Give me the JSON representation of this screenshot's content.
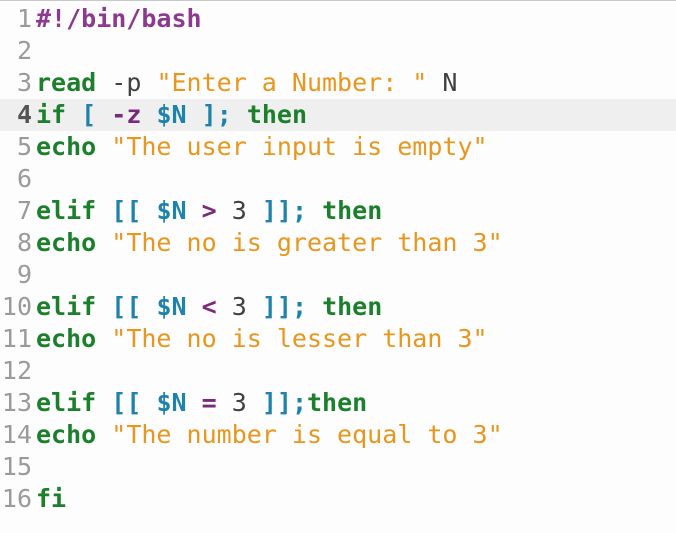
{
  "editor": {
    "current_line": 4,
    "lines": [
      {
        "number": "1",
        "tokens": [
          {
            "t": "#!/bin/bash",
            "c": "shebang"
          }
        ]
      },
      {
        "number": "2",
        "tokens": []
      },
      {
        "number": "3",
        "tokens": [
          {
            "t": "read",
            "c": "kw"
          },
          {
            "t": " -p ",
            "c": "plain"
          },
          {
            "t": "\"Enter a Number: \"",
            "c": "str"
          },
          {
            "t": " N",
            "c": "plain"
          }
        ]
      },
      {
        "number": "4",
        "tokens": [
          {
            "t": "if",
            "c": "kw"
          },
          {
            "t": " ",
            "c": "plain"
          },
          {
            "t": "[",
            "c": "brk"
          },
          {
            "t": " ",
            "c": "plain"
          },
          {
            "t": "-z",
            "c": "op"
          },
          {
            "t": " ",
            "c": "plain"
          },
          {
            "t": "$N",
            "c": "var"
          },
          {
            "t": " ",
            "c": "plain"
          },
          {
            "t": "];",
            "c": "brk"
          },
          {
            "t": " ",
            "c": "plain"
          },
          {
            "t": "then",
            "c": "kw"
          }
        ]
      },
      {
        "number": "5",
        "tokens": [
          {
            "t": "echo",
            "c": "kw"
          },
          {
            "t": " ",
            "c": "plain"
          },
          {
            "t": "\"The user input is empty\"",
            "c": "str"
          }
        ]
      },
      {
        "number": "6",
        "tokens": []
      },
      {
        "number": "7",
        "tokens": [
          {
            "t": "elif",
            "c": "kw"
          },
          {
            "t": " ",
            "c": "plain"
          },
          {
            "t": "[[",
            "c": "brk"
          },
          {
            "t": " ",
            "c": "plain"
          },
          {
            "t": "$N",
            "c": "var"
          },
          {
            "t": " ",
            "c": "plain"
          },
          {
            "t": ">",
            "c": "op"
          },
          {
            "t": " 3 ",
            "c": "plain"
          },
          {
            "t": "]];",
            "c": "brk"
          },
          {
            "t": " ",
            "c": "plain"
          },
          {
            "t": "then",
            "c": "kw"
          }
        ]
      },
      {
        "number": "8",
        "tokens": [
          {
            "t": "echo",
            "c": "kw"
          },
          {
            "t": " ",
            "c": "plain"
          },
          {
            "t": "\"The no is greater than 3\"",
            "c": "str"
          }
        ]
      },
      {
        "number": "9",
        "tokens": []
      },
      {
        "number": "10",
        "tokens": [
          {
            "t": "elif",
            "c": "kw"
          },
          {
            "t": " ",
            "c": "plain"
          },
          {
            "t": "[[",
            "c": "brk"
          },
          {
            "t": " ",
            "c": "plain"
          },
          {
            "t": "$N",
            "c": "var"
          },
          {
            "t": " ",
            "c": "plain"
          },
          {
            "t": "<",
            "c": "op"
          },
          {
            "t": " 3 ",
            "c": "plain"
          },
          {
            "t": "]];",
            "c": "brk"
          },
          {
            "t": " ",
            "c": "plain"
          },
          {
            "t": "then",
            "c": "kw"
          }
        ]
      },
      {
        "number": "11",
        "tokens": [
          {
            "t": "echo",
            "c": "kw"
          },
          {
            "t": " ",
            "c": "plain"
          },
          {
            "t": "\"The no is lesser than 3\"",
            "c": "str"
          }
        ]
      },
      {
        "number": "12",
        "tokens": []
      },
      {
        "number": "13",
        "tokens": [
          {
            "t": "elif",
            "c": "kw"
          },
          {
            "t": " ",
            "c": "plain"
          },
          {
            "t": "[[",
            "c": "brk"
          },
          {
            "t": " ",
            "c": "plain"
          },
          {
            "t": "$N",
            "c": "var"
          },
          {
            "t": " ",
            "c": "plain"
          },
          {
            "t": "=",
            "c": "op"
          },
          {
            "t": " 3 ",
            "c": "plain"
          },
          {
            "t": "]];",
            "c": "brk"
          },
          {
            "t": "then",
            "c": "kw"
          }
        ]
      },
      {
        "number": "14",
        "tokens": [
          {
            "t": "echo",
            "c": "kw"
          },
          {
            "t": " ",
            "c": "plain"
          },
          {
            "t": "\"The number is equal to 3\"",
            "c": "str"
          }
        ]
      },
      {
        "number": "15",
        "tokens": []
      },
      {
        "number": "16",
        "tokens": [
          {
            "t": "fi",
            "c": "kw"
          }
        ]
      }
    ]
  },
  "colors": {
    "keyword": "#1b7f2b",
    "shebang": "#8b3a8f",
    "string": "#e8961e",
    "variable": "#1d83ad",
    "operator": "#7a2a7a",
    "plain": "#404040",
    "line_number": "#9a9a9a",
    "current_line_bg": "#efefef"
  }
}
